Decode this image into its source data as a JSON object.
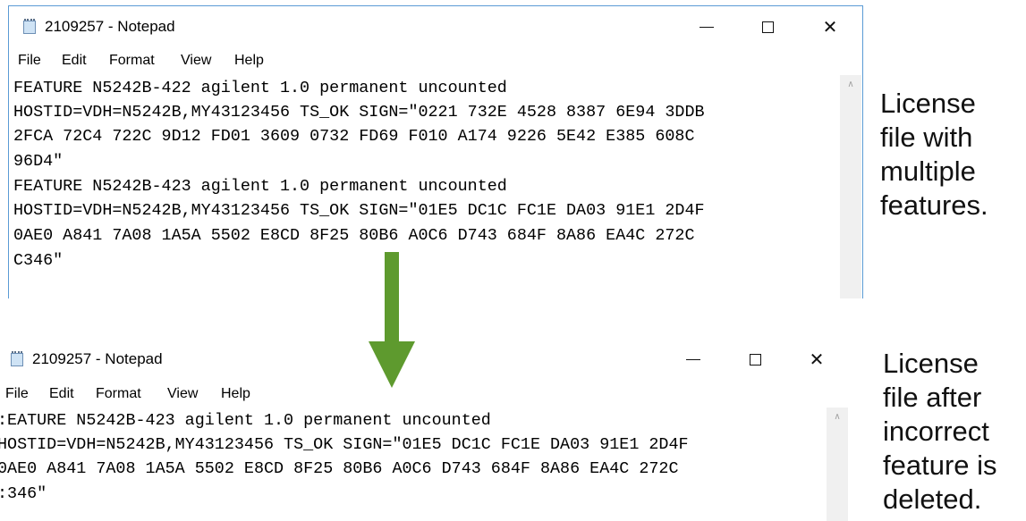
{
  "windows": [
    {
      "title": "2109257 - Notepad",
      "menu": [
        "File",
        "Edit",
        "Format",
        "View",
        "Help"
      ],
      "lines": [
        "FEATURE N5242B-422 agilent 1.0 permanent uncounted",
        "HOSTID=VDH=N5242B,MY43123456 TS_OK SIGN=\"0221 732E 4528 8387 6E94 3DDB",
        "2FCA 72C4 722C 9D12 FD01 3609 0732 FD69 F010 A174 9226 5E42 E385 608C",
        "96D4\"",
        "FEATURE N5242B-423 agilent 1.0 permanent uncounted",
        "HOSTID=VDH=N5242B,MY43123456 TS_OK SIGN=\"01E5 DC1C FC1E DA03 91E1 2D4F",
        "0AE0 A841 7A08 1A5A 5502 E8CD 8F25 80B6 A0C6 D743 684F 8A86 EA4C 272C",
        "C346\""
      ]
    },
    {
      "title": "2109257 - Notepad",
      "menu": [
        "File",
        "Edit",
        "Format",
        "View",
        "Help"
      ],
      "lines": [
        ":EATURE N5242B-423 agilent 1.0 permanent uncounted",
        "HOSTID=VDH=N5242B,MY43123456 TS_OK SIGN=\"01E5 DC1C FC1E DA03 91E1 2D4F",
        "0AE0 A841 7A08 1A5A 5502 E8CD 8F25 80B6 A0C6 D743 684F 8A86 EA4C 272C",
        ":346\""
      ]
    }
  ],
  "window_controls": {
    "minimize": "—",
    "close": "✕"
  },
  "captions": {
    "top": [
      "License",
      "file with",
      "multiple",
      "features."
    ],
    "bottom": [
      "License",
      "file after",
      "incorrect",
      "feature is",
      "deleted."
    ]
  },
  "colors": {
    "arrow": "#5e9a2e",
    "window_border": "#5b9bd5"
  }
}
